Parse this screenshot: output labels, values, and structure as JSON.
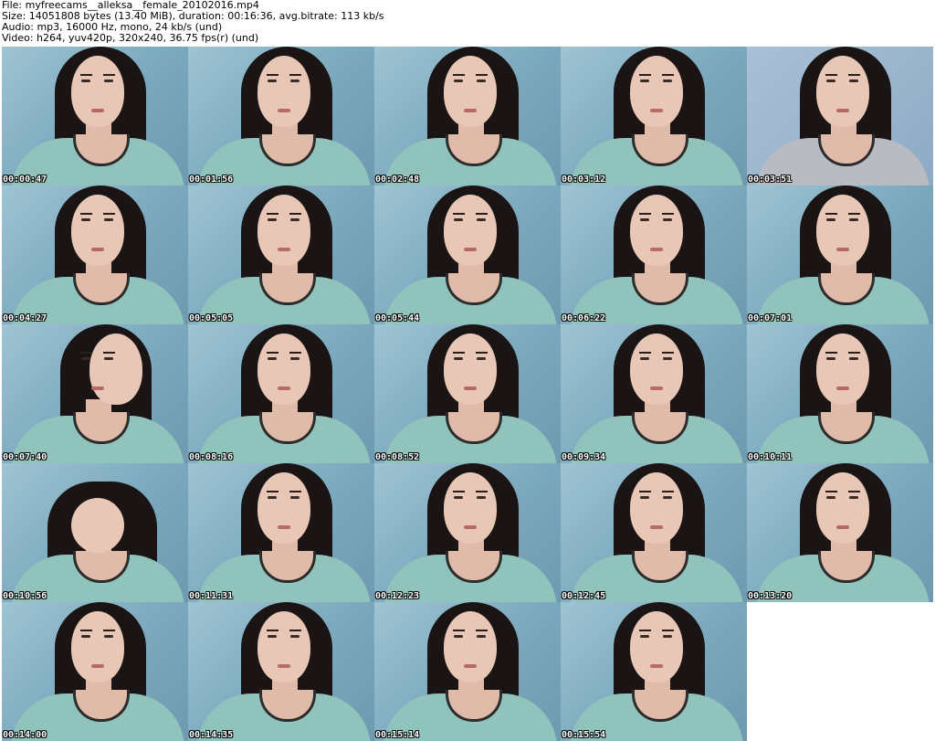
{
  "header": {
    "file_line": "File: myfreecams__alleksa__female_20102016.mp4",
    "size_line": "Size: 14051808 bytes (13.40 MiB), duration: 00:16:36, avg.bitrate: 113 kb/s",
    "audio_line": "Audio: mp3, 16000 Hz, mono, 24 kb/s (und)",
    "video_line": "Video: h264, yuv420p, 320x240, 36.75 fps(r) (und)"
  },
  "frames": [
    {
      "timestamp": "00:00:47",
      "variant": "normal"
    },
    {
      "timestamp": "00:01:56",
      "variant": "normal"
    },
    {
      "timestamp": "00:02:48",
      "variant": "normal"
    },
    {
      "timestamp": "00:03:12",
      "variant": "normal"
    },
    {
      "timestamp": "00:03:51",
      "variant": "grey"
    },
    {
      "timestamp": "00:04:27",
      "variant": "normal"
    },
    {
      "timestamp": "00:05:05",
      "variant": "normal"
    },
    {
      "timestamp": "00:05:44",
      "variant": "normal"
    },
    {
      "timestamp": "00:06:22",
      "variant": "normal"
    },
    {
      "timestamp": "00:07:01",
      "variant": "normal"
    },
    {
      "timestamp": "00:07:40",
      "variant": "side"
    },
    {
      "timestamp": "00:08:16",
      "variant": "normal"
    },
    {
      "timestamp": "00:08:52",
      "variant": "normal"
    },
    {
      "timestamp": "00:09:34",
      "variant": "normal"
    },
    {
      "timestamp": "00:10:11",
      "variant": "normal"
    },
    {
      "timestamp": "00:10:56",
      "variant": "headdown"
    },
    {
      "timestamp": "00:11:31",
      "variant": "normal"
    },
    {
      "timestamp": "00:12:23",
      "variant": "normal"
    },
    {
      "timestamp": "00:12:45",
      "variant": "normal"
    },
    {
      "timestamp": "00:13:20",
      "variant": "normal"
    },
    {
      "timestamp": "00:14:00",
      "variant": "normal"
    },
    {
      "timestamp": "00:14:35",
      "variant": "normal"
    },
    {
      "timestamp": "00:15:14",
      "variant": "normal"
    },
    {
      "timestamp": "00:15:54",
      "variant": "normal"
    }
  ]
}
